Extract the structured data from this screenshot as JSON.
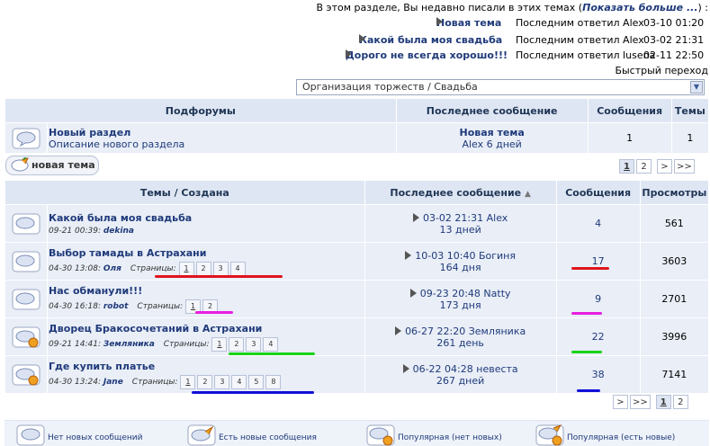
{
  "recent": {
    "intro": "В этом разделе, Вы недавно писали в этих темах (",
    "more": "Показать больше ...",
    "intro_end": ") :",
    "items": [
      {
        "title": "Новая тема",
        "by": "Последним ответил Alex",
        "date": "03-10 01:20"
      },
      {
        "title": "Какой была моя свадьба",
        "by": "Последним ответил Alex",
        "date": "03-02 21:31"
      },
      {
        "title": "Дорого не всегда хорошо!!!",
        "by": "Последним ответил lusena",
        "date": "02-11 22:50"
      }
    ]
  },
  "quick_jump": {
    "label": "Быстрый переход",
    "selected": "Организация торжеств / Свадьба"
  },
  "subforums": {
    "headers": [
      "Подфорумы",
      "Последнее сообщение",
      "Сообщения",
      "Темы"
    ],
    "rows": [
      {
        "title": "Новый раздел",
        "desc": "Описание нового раздела",
        "last_title": "Новая тема",
        "last_info": "Alex 6 дней",
        "posts": "1",
        "topics": "1"
      }
    ]
  },
  "new_topic_button": "новая тема",
  "pager_top": [
    "1",
    "2",
    ">",
    ">>"
  ],
  "pager_bottom": [
    ">",
    ">>",
    "1",
    "2"
  ],
  "topics": {
    "headers": [
      "Темы / Создана",
      "Последнее сообщение",
      "Сообщения",
      "Просмотры"
    ],
    "pages_label": "Страницы:",
    "rows": [
      {
        "title": "Какой была моя свадьба",
        "created": "09-21 00:39:",
        "author": "dekina",
        "pages": [],
        "last": "03-02 21:31 Alex",
        "ago": "13 дней",
        "posts": "4",
        "views": "561",
        "hot": false
      },
      {
        "title": "Выбор тамады в Астрахани",
        "created": "04-30 13:08:",
        "author": "Оля",
        "pages": [
          "1",
          "2",
          "3",
          "4"
        ],
        "last": "10-03 10:40 Богиня",
        "ago": "164 дня",
        "posts": "17",
        "views": "3603",
        "hot": false
      },
      {
        "title": "Нас обманули!!!",
        "created": "04-30 16:18:",
        "author": "robot",
        "pages": [
          "1",
          "2"
        ],
        "last": "09-23 20:48 Natty",
        "ago": "173 дня",
        "posts": "9",
        "views": "2701",
        "hot": false
      },
      {
        "title": "Дворец Бракосочетаний в Астрахани",
        "created": "09-21 14:41:",
        "author": "Земляника",
        "pages": [
          "1",
          "2",
          "3",
          "4"
        ],
        "last": "06-27 22:20 Земляника",
        "ago": "261 день",
        "posts": "22",
        "views": "3996",
        "hot": true
      },
      {
        "title": "Где купить платье",
        "created": "04-30 13:24:",
        "author": "Jane",
        "pages": [
          "1",
          "2",
          "3",
          "4",
          "5",
          "8"
        ],
        "last": "06-22 04:28 невеста",
        "ago": "267 дней",
        "posts": "38",
        "views": "7141",
        "hot": true
      }
    ]
  },
  "legend": [
    "Нет новых сообщений",
    "Есть новые сообщения",
    "Популярная (нет новых)",
    "Популярная (есть новые)"
  ],
  "colors": {
    "red": "#e0141e",
    "magenta": "#e81ee0",
    "green": "#18d418",
    "blue": "#1010d8",
    "header_bg": "#dfe6f3",
    "row_bg": "#e9eef7",
    "link": "#1f3a7a"
  }
}
